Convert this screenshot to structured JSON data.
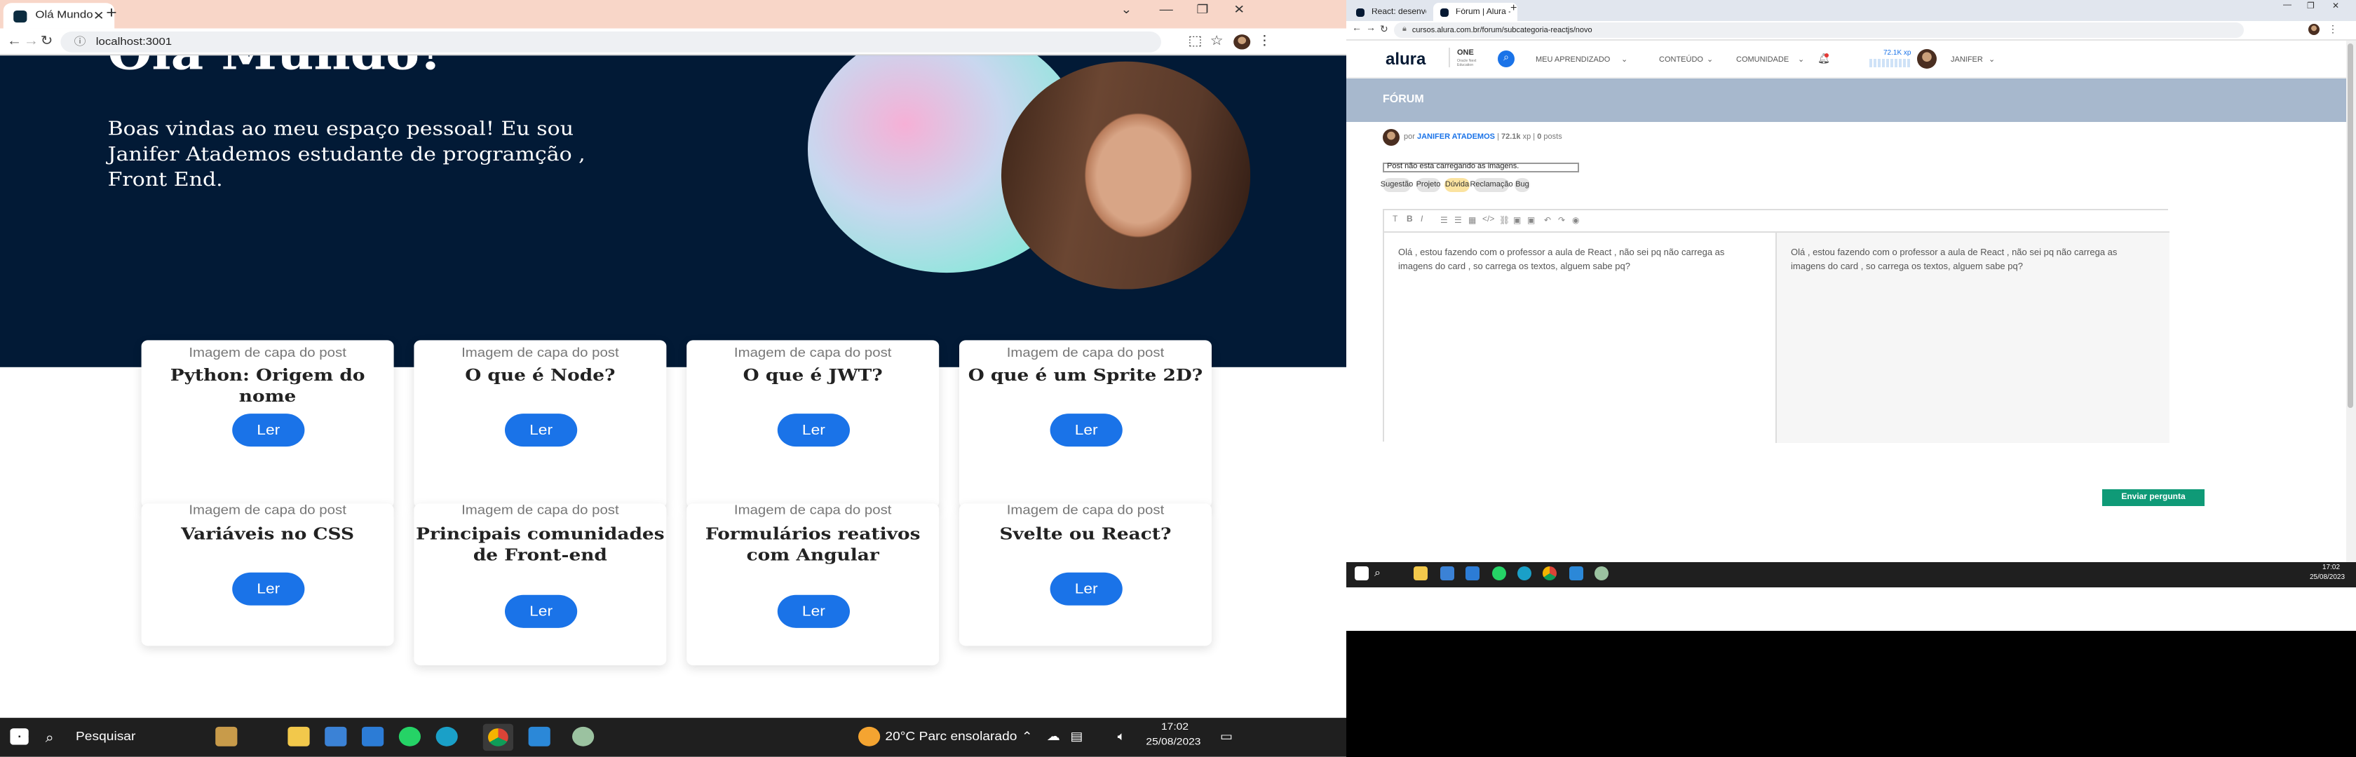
{
  "left_window": {
    "tab_title": "Olá Mundo",
    "url": "localhost:3001",
    "hero": {
      "heading": "Olá Mundo!",
      "intro": "Boas vindas ao meu espaço pessoal! Eu sou Janifer Atademos estudante de programção , Front End."
    },
    "cards": [
      {
        "img_alt": "Imagem de capa do post",
        "title": "Python: Origem do nome",
        "button": "Ler"
      },
      {
        "img_alt": "Imagem de capa do post",
        "title": "O que é Node?",
        "button": "Ler"
      },
      {
        "img_alt": "Imagem de capa do post",
        "title": "O que é JWT?",
        "button": "Ler"
      },
      {
        "img_alt": "Imagem de capa do post",
        "title": "O que é um Sprite 2D?",
        "button": "Ler"
      },
      {
        "img_alt": "Imagem de capa do post",
        "title": "Variáveis no CSS",
        "button": "Ler"
      },
      {
        "img_alt": "Imagem de capa do post",
        "title": "Principais comunidades de Front-end",
        "button": "Ler"
      },
      {
        "img_alt": "Imagem de capa do post",
        "title": "Formulários reativos com Angular",
        "button": "Ler"
      },
      {
        "img_alt": "Imagem de capa do post",
        "title": "Svelte ou React?",
        "button": "Ler"
      }
    ],
    "taskbar": {
      "search": "Pesquisar",
      "weather": "20°C  Parc ensolarado",
      "time": "17:02",
      "date": "25/08/2023"
    }
  },
  "right_window": {
    "tabs": [
      "React: desenvolvendo em React ...",
      "Fórum | Alura - Cursos online de..."
    ],
    "url": "cursos.alura.com.br/forum/subcategoria-reactjs/novo",
    "nav": {
      "logo": "alura",
      "one_title": "ONE",
      "one_subtitle": "Oracle Next Education",
      "menu": [
        "MEU APRENDIZADO",
        "CONTEÚDO",
        "COMUNIDADE"
      ],
      "xp": "72.1K xp",
      "user": "JANIFER"
    },
    "forum_title": "FÓRUM",
    "author": {
      "prefix": "por",
      "name": "JANIFER ATADEMOS",
      "xp": "72.1k",
      "xp_unit": "xp",
      "posts": "0",
      "posts_unit": "posts"
    },
    "post_title": "Post não esta carregando as imagens.",
    "tags": [
      "Sugestão",
      "Projeto",
      "Dúvida",
      "Reclamação",
      "Bug"
    ],
    "selected_tag": "Dúvida",
    "editor_text": "Olá , estou fazendo com o professor a aula de React , não sei pq não carrega as imagens do card , so carrega os textos, alguem sabe pq?",
    "preview_text": "Olá , estou fazendo com o professor a aula de React , não sei pq não carrega as imagens do card , so carrega os textos, alguem sabe pq?",
    "submit": "Enviar pergunta",
    "clock": {
      "time": "17:02",
      "date": "25/08/2023"
    }
  }
}
